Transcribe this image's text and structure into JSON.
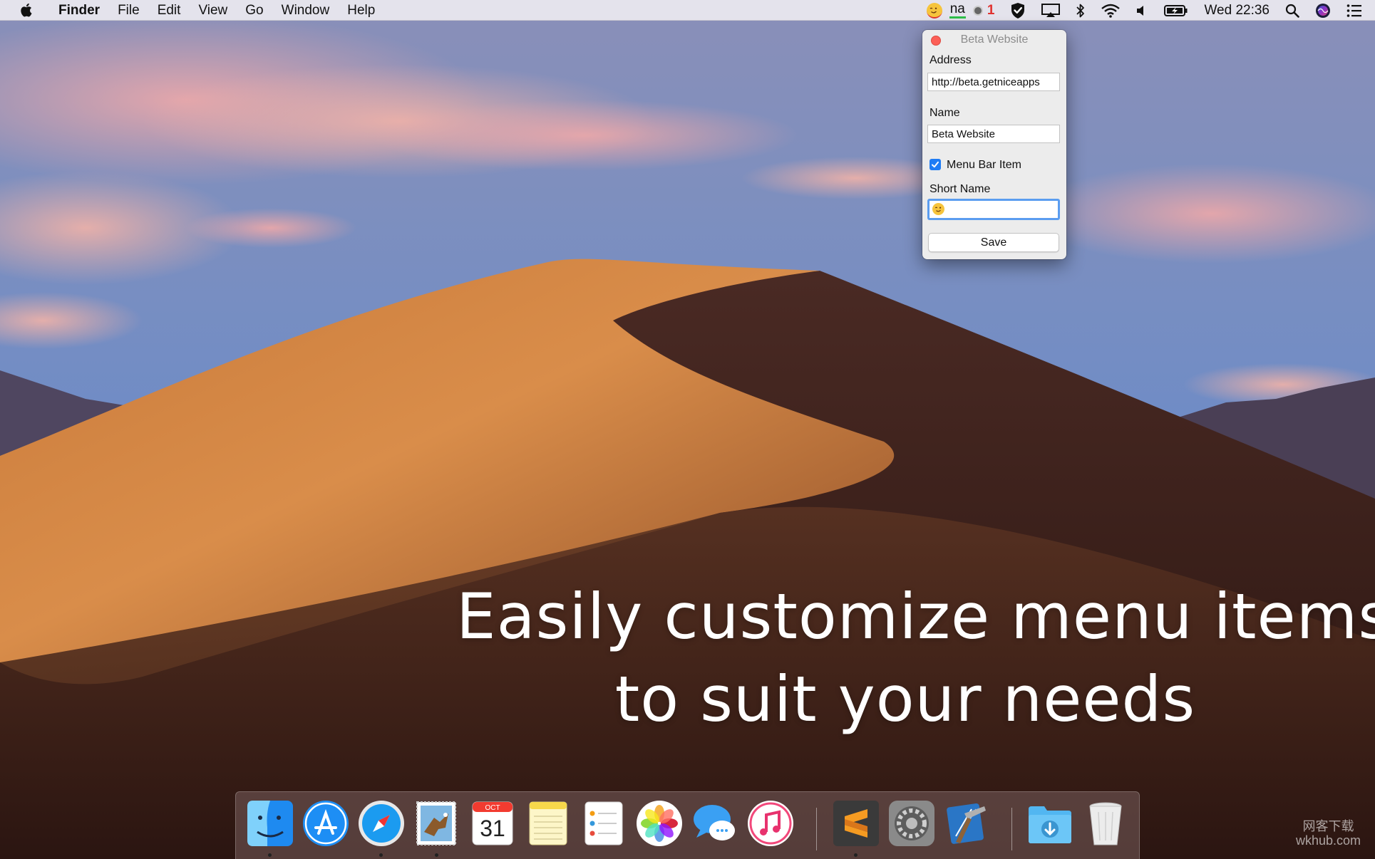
{
  "menubar": {
    "app_name": "Finder",
    "menus": [
      "File",
      "Edit",
      "View",
      "Go",
      "Window",
      "Help"
    ],
    "status": {
      "short_label": "na",
      "badge_count": "1",
      "clock": "Wed 22:36"
    }
  },
  "popover": {
    "title": "Beta Website",
    "address_label": "Address",
    "address_value": "http://beta.getniceapps",
    "name_label": "Name",
    "name_value": "Beta Website",
    "menu_bar_item_label": "Menu Bar Item",
    "menu_bar_item_checked": true,
    "short_name_label": "Short Name",
    "save_label": "Save"
  },
  "headline": {
    "line1": "Easily customize menu items",
    "line2": "to suit your needs"
  },
  "dock": {
    "items": [
      "finder-icon",
      "app-store-icon",
      "safari-icon",
      "mail-icon",
      "calendar-icon",
      "notes-icon",
      "reminders-icon",
      "photos-icon",
      "messages-icon",
      "itunes-icon",
      "sublime-text-icon",
      "system-preferences-icon",
      "xcode-icon",
      "downloads-folder-icon",
      "trash-icon"
    ],
    "calendar_month": "OCT",
    "calendar_day": "31"
  },
  "watermark": {
    "line1": "网客下载",
    "line2": "wkhub.com"
  },
  "colors": {
    "accent": "#1e7cf5",
    "focus_ring": "#5b9df0",
    "close_red": "#fc5f57"
  }
}
